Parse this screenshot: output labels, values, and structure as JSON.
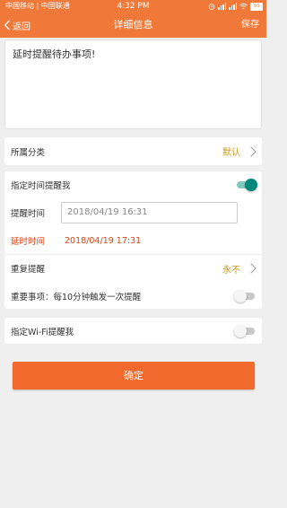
{
  "status_bar": {
    "carrier_1": "中国移动",
    "carrier_2": "中国联通",
    "time": "4:32 PM",
    "battery": "93"
  },
  "nav": {
    "back_label": "返回",
    "title": "详细信息",
    "save_label": "保存"
  },
  "content": {
    "text": "延时提醒待办事项!"
  },
  "category": {
    "label": "所属分类",
    "value": "默认"
  },
  "time_reminder": {
    "label": "指定时间提醒我",
    "enabled": true,
    "reminder_time_label": "提醒时间",
    "reminder_time_value": "2018/04/19 16:31",
    "delay_label": "延时时间",
    "delay_value": "2018/04/19 17:31",
    "repeat_label": "重复提醒",
    "repeat_value": "永不",
    "important_label": "重要事项：每10分钟触发一次提醒",
    "important_enabled": false
  },
  "wifi_reminder": {
    "label": "指定Wi-Fi提醒我",
    "enabled": false
  },
  "confirm_label": "确定",
  "colors": {
    "accent": "#f0793a",
    "button": "#f26a2e",
    "toggle_on": "#00897b",
    "gold": "#c99a1d",
    "red": "#d84315"
  }
}
